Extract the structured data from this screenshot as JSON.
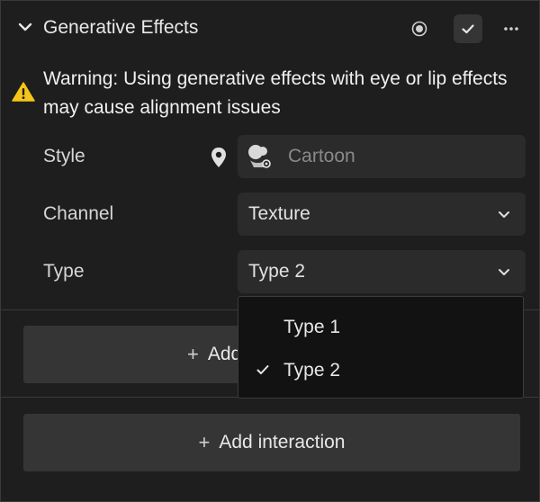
{
  "header": {
    "title": "Generative Effects"
  },
  "warning": {
    "text": "Warning: Using generative effects with eye or lip effects may cause alignment issues"
  },
  "fields": {
    "style": {
      "label": "Style",
      "value": "Cartoon"
    },
    "channel": {
      "label": "Channel",
      "value": "Texture"
    },
    "type": {
      "label": "Type",
      "value": "Type 2"
    }
  },
  "dropdown": {
    "options": [
      {
        "label": "Type 1",
        "selected": false
      },
      {
        "label": "Type 2",
        "selected": true
      }
    ]
  },
  "buttons": {
    "add_partial": "Add",
    "add_interaction": "Add interaction",
    "plus_glyph": "+"
  },
  "colors": {
    "background": "#1e1e1e",
    "field_bg": "#2b2b2b",
    "button_bg": "#353535",
    "warning": "#f5c518",
    "dropdown_bg": "#121212"
  }
}
